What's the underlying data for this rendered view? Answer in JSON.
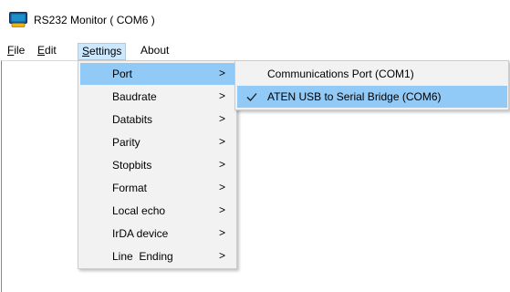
{
  "window": {
    "title": "RS232 Monitor ( COM6 )"
  },
  "menubar": {
    "file_mnemonic": "F",
    "file_rest": "ile",
    "edit_mnemonic": "E",
    "edit_rest": "dit",
    "settings_mnemonic": "S",
    "settings_rest": "ettings",
    "about_label": "About"
  },
  "settings_menu": {
    "items": [
      {
        "label": "Port",
        "arrow": ">"
      },
      {
        "label": "Baudrate",
        "arrow": ">"
      },
      {
        "label": "Databits",
        "arrow": ">"
      },
      {
        "label": "Parity",
        "arrow": ">"
      },
      {
        "label": "Stopbits",
        "arrow": ">"
      },
      {
        "label": "Format",
        "arrow": ">"
      },
      {
        "label": "Local echo",
        "arrow": ">"
      },
      {
        "label": "IrDA device",
        "arrow": ">"
      },
      {
        "label": "Line  Ending",
        "arrow": ">"
      }
    ],
    "highlighted_item": "Port"
  },
  "port_submenu": {
    "items": [
      {
        "label": "Communications Port (COM1)",
        "checked": false
      },
      {
        "label": "ATEN USB to Serial Bridge (COM6)",
        "checked": true
      }
    ]
  },
  "colors": {
    "menu_highlight": "#91c9f7",
    "menubar_open": "#cce8ff",
    "menu_background": "#f2f2f2"
  },
  "icons": {
    "app": "monitor-icon",
    "submenu_arrow": "chevron-right-icon",
    "check": "checkmark-icon"
  }
}
